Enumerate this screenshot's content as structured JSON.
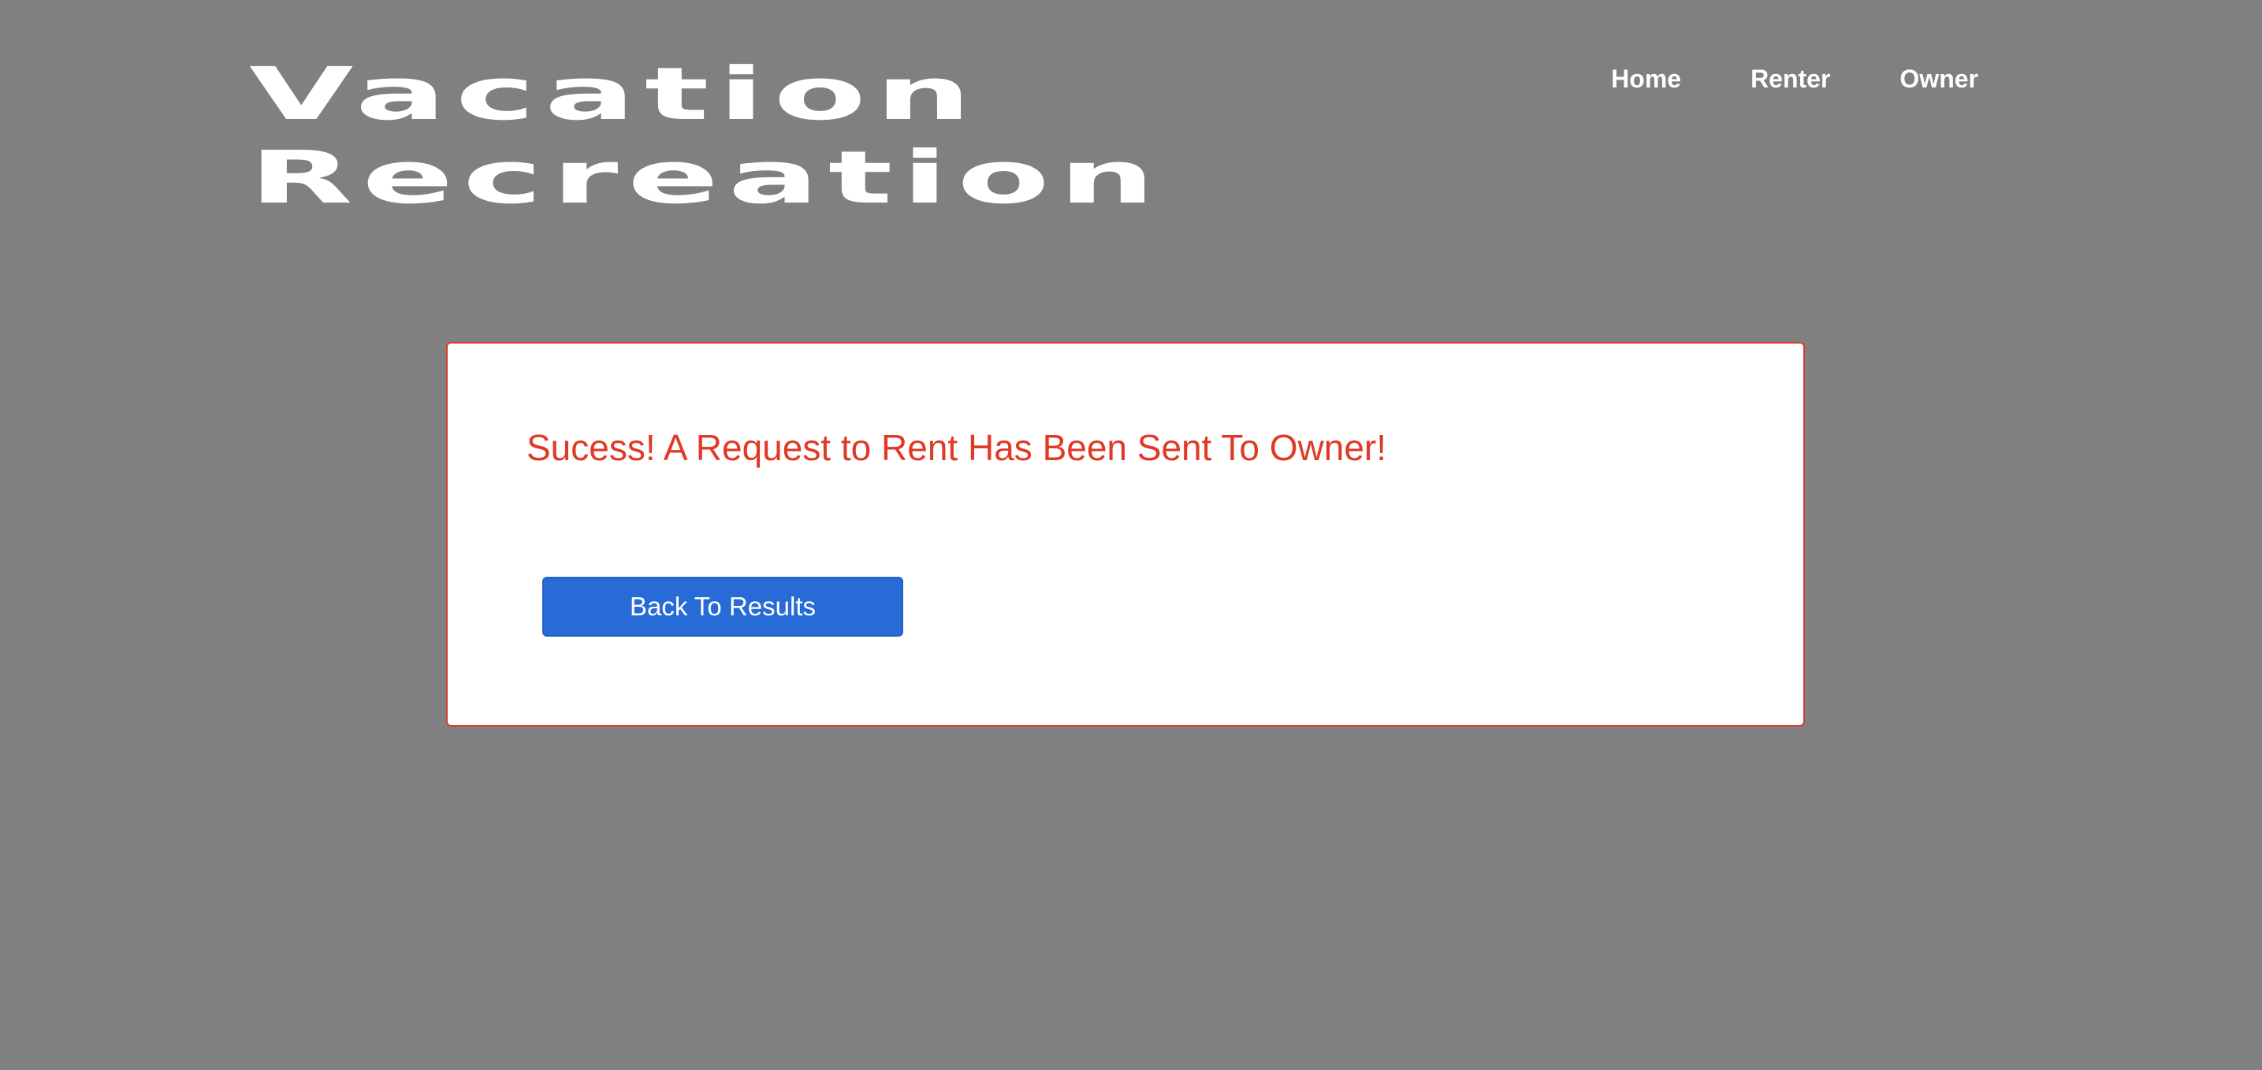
{
  "header": {
    "title_line1": "Vacation",
    "title_line2": "Recreation",
    "nav": {
      "home": "Home",
      "renter": "Renter",
      "owner": "Owner"
    }
  },
  "main": {
    "message": "Sucess! A Request to Rent Has Been Sent To Owner!",
    "back_button_label": "Back To Results"
  },
  "colors": {
    "page_background": "#808080",
    "message_text": "#e03a26",
    "card_border": "#dc3a2a",
    "button_background": "#276bd6",
    "title_text": "#ffffff"
  }
}
